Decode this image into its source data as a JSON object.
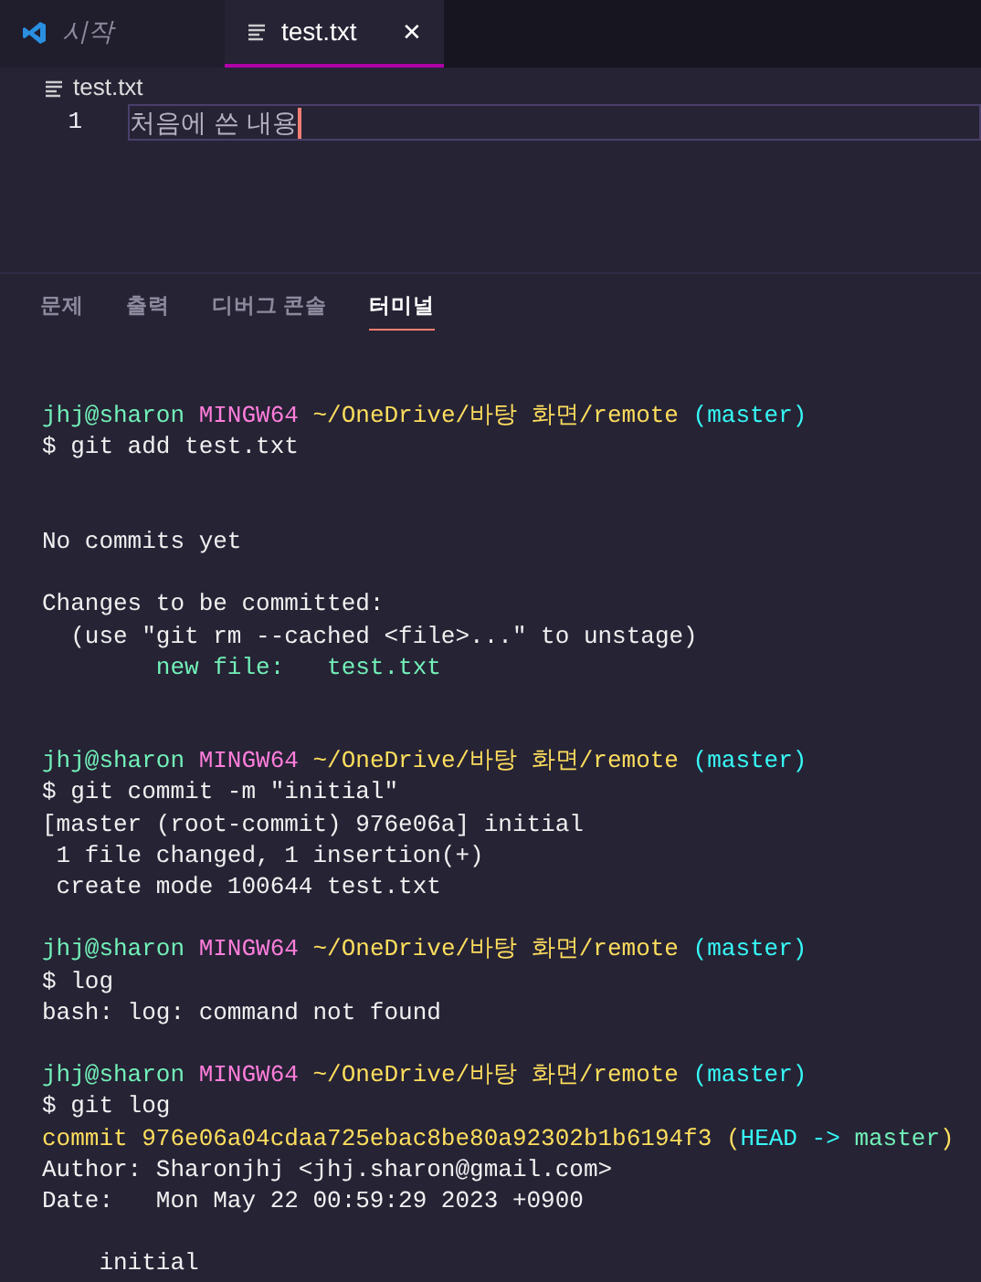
{
  "tabs": [
    {
      "label": "시작",
      "kind": "welcome",
      "selected": false
    },
    {
      "label": "test.txt",
      "kind": "file",
      "selected": true,
      "close": "✕"
    }
  ],
  "breadcrumb": "test.txt",
  "editor": {
    "lines": [
      {
        "number": "1",
        "text": "처음에 쓴 내용",
        "current": true
      }
    ]
  },
  "panel_tabs": [
    {
      "label": "문제",
      "selected": false
    },
    {
      "label": "출력",
      "selected": false
    },
    {
      "label": "디버그 콘솔",
      "selected": false
    },
    {
      "label": "터미널",
      "selected": true
    }
  ],
  "terminal": [
    {
      "kind": "blank"
    },
    {
      "kind": "line",
      "segments": [
        {
          "kind": "user",
          "text": "jhj@sharon"
        },
        {
          "kind": "host",
          "text": "MINGW64"
        },
        {
          "kind": "path",
          "text": "~/OneDrive/바탕 화면/remote"
        },
        {
          "kind": "branch",
          "text": "(master)"
        }
      ]
    },
    {
      "kind": "line",
      "segments": [
        {
          "kind": "text",
          "text": "$ git add test.txt"
        }
      ]
    },
    {
      "kind": "blank"
    },
    {
      "kind": "blank"
    },
    {
      "kind": "line",
      "segments": [
        {
          "kind": "text",
          "text": "No commits yet"
        }
      ]
    },
    {
      "kind": "blank"
    },
    {
      "kind": "line",
      "segments": [
        {
          "kind": "text",
          "text": "Changes to be committed:"
        }
      ]
    },
    {
      "kind": "line",
      "segments": [
        {
          "kind": "text",
          "text": "  (use \"git rm --cached <file>...\" to unstage)"
        }
      ]
    },
    {
      "kind": "line",
      "segments": [
        {
          "kind": "added",
          "text": "        new file:   test.txt"
        }
      ]
    },
    {
      "kind": "blank"
    },
    {
      "kind": "blank"
    },
    {
      "kind": "line",
      "segments": [
        {
          "kind": "user",
          "text": "jhj@sharon"
        },
        {
          "kind": "host",
          "text": "MINGW64"
        },
        {
          "kind": "path",
          "text": "~/OneDrive/바탕 화면/remote"
        },
        {
          "kind": "branch",
          "text": "(master)"
        }
      ]
    },
    {
      "kind": "line",
      "segments": [
        {
          "kind": "text",
          "text": "$ git commit -m \"initial\""
        }
      ]
    },
    {
      "kind": "line",
      "segments": [
        {
          "kind": "text",
          "text": "[master (root-commit) 976e06a] initial"
        }
      ]
    },
    {
      "kind": "line",
      "segments": [
        {
          "kind": "text",
          "text": " 1 file changed, 1 insertion(+)"
        }
      ]
    },
    {
      "kind": "line",
      "segments": [
        {
          "kind": "text",
          "text": " create mode 100644 test.txt"
        }
      ]
    },
    {
      "kind": "blank"
    },
    {
      "kind": "line",
      "segments": [
        {
          "kind": "user",
          "text": "jhj@sharon"
        },
        {
          "kind": "host",
          "text": "MINGW64"
        },
        {
          "kind": "path",
          "text": "~/OneDrive/바탕 화면/remote"
        },
        {
          "kind": "branch",
          "text": "(master)"
        }
      ]
    },
    {
      "kind": "line",
      "segments": [
        {
          "kind": "text",
          "text": "$ log"
        }
      ]
    },
    {
      "kind": "line",
      "segments": [
        {
          "kind": "text",
          "text": "bash: log: command not found"
        }
      ]
    },
    {
      "kind": "blank"
    },
    {
      "kind": "line",
      "segments": [
        {
          "kind": "user",
          "text": "jhj@sharon"
        },
        {
          "kind": "host",
          "text": "MINGW64"
        },
        {
          "kind": "path",
          "text": "~/OneDrive/바탕 화면/remote"
        },
        {
          "kind": "branch",
          "text": "(master)"
        }
      ]
    },
    {
      "kind": "line",
      "segments": [
        {
          "kind": "text",
          "text": "$ git log"
        }
      ]
    },
    {
      "kind": "line",
      "segments": [
        {
          "kind": "commit",
          "text": "commit 976e06a04cdaa725ebac8be80a92302b1b6194f3 ("
        },
        {
          "kind": "head",
          "text": "HEAD -> "
        },
        {
          "kind": "added",
          "text": "master"
        },
        {
          "kind": "commit",
          "text": ")"
        }
      ]
    },
    {
      "kind": "line",
      "segments": [
        {
          "kind": "text",
          "text": "Author: Sharonjhj <jhj.sharon@gmail.com>"
        }
      ]
    },
    {
      "kind": "line",
      "segments": [
        {
          "kind": "text",
          "text": "Date:   Mon May 22 00:59:29 2023 +0900"
        }
      ]
    },
    {
      "kind": "blank"
    },
    {
      "kind": "line",
      "segments": [
        {
          "kind": "text",
          "text": "    initial"
        }
      ]
    }
  ]
}
